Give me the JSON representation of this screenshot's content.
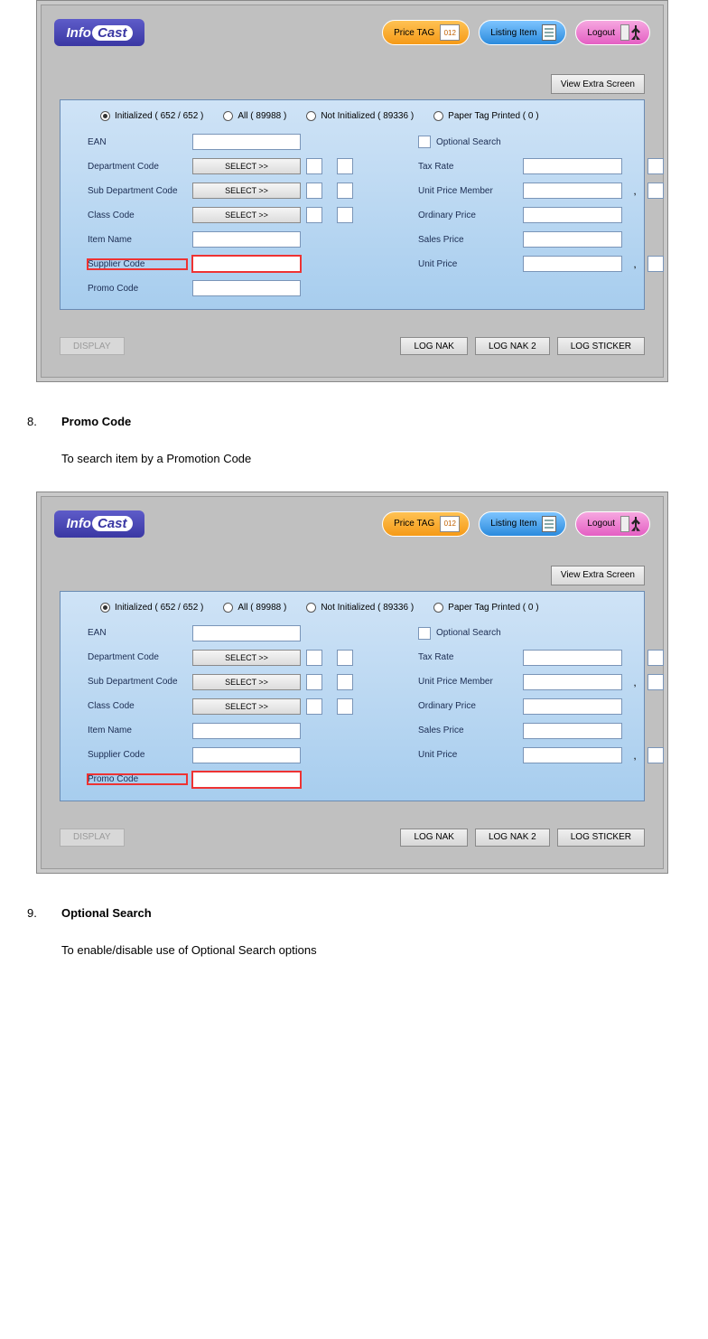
{
  "logo": {
    "part1": "Info",
    "part2": "Cast"
  },
  "top_buttons": {
    "price_tag": "Price TAG",
    "price_tag_badge": "012",
    "listing_item": "Listing Item",
    "logout": "Logout"
  },
  "aux_button": "View Extra Screen",
  "radio": {
    "initialized": "Initialized  ( 652 / 652 )",
    "all": "All  ( 89988 )",
    "not_initialized": "Not Initialized  ( 89336 )",
    "paper_tag": "Paper Tag Printed  ( 0 )"
  },
  "labels": {
    "ean": "EAN",
    "dept": "Department Code",
    "subdept": "Sub Department Code",
    "class": "Class Code",
    "item": "Item Name",
    "supplier": "Supplier Code",
    "promo": "Promo Code",
    "optsearch": "Optional Search",
    "taxrate": "Tax Rate",
    "unit_member": "Unit Price Member",
    "ordinary": "Ordinary Price",
    "sales": "Sales Price",
    "unit": "Unit Price"
  },
  "select_btn": "SELECT >>",
  "bottom_buttons": {
    "display": "DISPLAY",
    "log_nak": "LOG NAK",
    "log_nak2": "LOG NAK 2",
    "log_sticker": "LOG STICKER"
  },
  "sections": {
    "s8": {
      "num": "8.",
      "title": "Promo Code",
      "desc": "To search item by a Promotion Code",
      "highlight": "supplier"
    },
    "s9": {
      "num": "9.",
      "title": "Optional Search",
      "desc": "To enable/disable use of Optional Search options",
      "highlight": "promo"
    }
  }
}
